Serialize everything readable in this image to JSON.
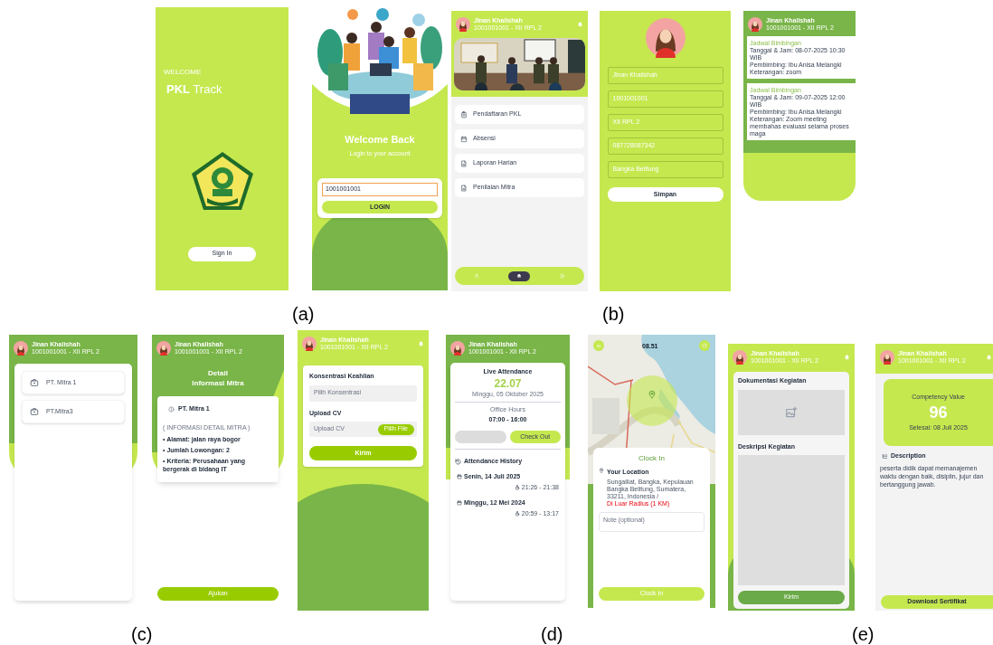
{
  "figure": {
    "screens": [
      {
        "kind": "splash",
        "greeting": "WELCOME",
        "title": "**PKL** Track",
        "button": "Sign In"
      },
      {
        "kind": "login",
        "title": "Welcome Back",
        "subtitle": "Login to your account",
        "username": "1001001001",
        "button": "LOGIN"
      },
      {
        "kind": "home",
        "user": {
          "name": "Jinan Khalishah",
          "detail": "1001001001 - XII RPL 2"
        },
        "menu": [
          "Pendaftaran PKL",
          "Absensi",
          "Laporan Harian",
          "Penilaian Mitra"
        ],
        "nav": [
          {
            "selected": false
          },
          {
            "selected": true
          },
          {
            "selected": false
          }
        ]
      },
      {
        "kind": "profile",
        "fields": [
          "Jinan Khalishah",
          "1001001001",
          "XII RPL 2",
          "087728087342",
          "Bangka Belitung"
        ],
        "button": "Simpan"
      },
      {
        "kind": "schedule",
        "user": {
          "name": "Jinan Khalishah",
          "detail": "1001001001 - XII RPL 2"
        },
        "entries": [
          {
            "title": "Jadwal Bimbingan",
            "lines": [
              "Tanggal & Jam: 08-07-2025 10:30 WIB",
              "Pembimbing: Ibu Anisa Melangki",
              "Keterangan: zoom"
            ]
          },
          {
            "title": "Jadwal Bimbingan",
            "lines": [
              "Tanggal & Jam: 09-07-2025 12:00 WIB",
              "Pembimbing: Ibu Anisa Melangki",
              "Keterangan: Zoom meeting membahas evaluasi selama proses maga"
            ]
          }
        ]
      },
      {
        "kind": "partners",
        "user": {
          "name": "Jinan Khalishah",
          "detail": "1001001001 - XII RPL 2"
        },
        "partners": [
          "PT. Mitra 1",
          "PT.Mitra3"
        ]
      },
      {
        "kind": "partner_detail",
        "user": {
          "name": "Jinan Khalishah",
          "detail": "1001001001 - XII RPL 2"
        },
        "title": [
          "Detail",
          "Informasi Mitra"
        ],
        "partner": "PT. Mitra 1",
        "section": "( INFORMASI DETAIL MITRA )",
        "details": [
          "• Alamat: jalan raya bogor",
          "• Jumlah Lowongan: 2",
          "• Kriteria: Perusahaan yang bergerak di bidang IT"
        ],
        "button": "Ajukan"
      },
      {
        "kind": "registration",
        "user": {
          "name": "Jinan Khalishah",
          "detail": "1001001001 - XII RPL 2"
        },
        "concentration_label": "Konsentrasi Keahlian",
        "concentration_placeholder": "Pilih Konsentrasi",
        "cv_label": "Upload CV",
        "cv_placeholder": "Upload CV",
        "file_button": "Pilih File",
        "button": "Kirim"
      },
      {
        "kind": "attendance",
        "user": {
          "name": "Jinan Khalishah",
          "detail": "1001001001 - XII RPL 2"
        },
        "heading": "Live Attendance",
        "time": "22.07",
        "date": "Minggu, 05 Oktober 2025",
        "hours_label": "Office Hours",
        "hours": "07:00 - 16:00",
        "buttons": [
          {
            "disabled": true
          },
          {
            "label": "Check Out",
            "disabled": false
          }
        ],
        "history_title": "Attendance History",
        "history": [
          {
            "date": "Senin, 14 Juli 2025",
            "time": "21:26 - 21:38"
          },
          {
            "date": "Minggu, 12 Mei 2024",
            "time": "20:59 - 13:17"
          }
        ]
      },
      {
        "kind": "clock_in",
        "time": "08.51",
        "title": "Clock In",
        "location_label": "Your Location",
        "address": "Sungailiat, Bangka, Kepulauan Bangka Belitung, Sumatera, 33211, Indonesia /",
        "radius_warning": "Di Luar Radius (1 KM)",
        "note_placeholder": "Note (optional)",
        "button": "Clock In"
      },
      {
        "kind": "daily_report",
        "user": {
          "name": "Jinan Khalishah",
          "detail": "1001001001 - XII RPL 2"
        },
        "documentation_label": "Dokumentasi Kegiatan",
        "description_label": "Deskripsi Kegiatan",
        "button": "Kirim"
      },
      {
        "kind": "certificate",
        "user": {
          "name": "Jinan Khalishah",
          "detail": "1001001001 - XII RPL 2"
        },
        "score_label": "Competency Value",
        "score": "96",
        "date": "Selesai: 08 Juli 2025",
        "description_label": "Description",
        "description": "peserta didik dapat memanajemen waktu dengan baik, disiplin, jujur dan bertanggung jawab.",
        "button": "Download Sertifikat"
      }
    ],
    "captions": [
      "(a)",
      "(b)",
      "(c)",
      "(d)",
      "(e)"
    ]
  }
}
